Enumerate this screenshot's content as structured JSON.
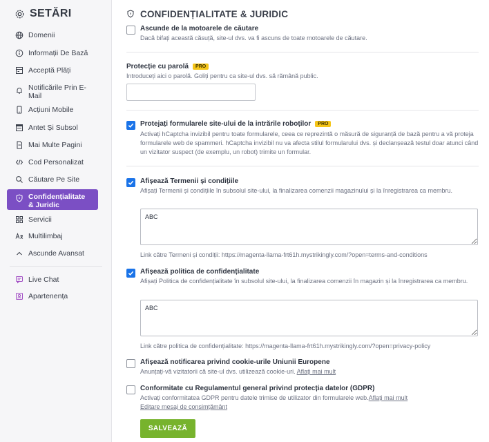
{
  "sidebar": {
    "title": "SETĂRI",
    "items": [
      {
        "label": "Domenii",
        "icon": "globe-icon"
      },
      {
        "label": "Informații De Bază",
        "icon": "info-icon"
      },
      {
        "label": "Acceptă Plăți",
        "icon": "payment-icon"
      },
      {
        "label": "Notificările Prin E-Mail",
        "icon": "bell-icon"
      },
      {
        "label": "Acțiuni Mobile",
        "icon": "mobile-icon"
      },
      {
        "label": "Antet Și Subsol",
        "icon": "header-footer-icon"
      },
      {
        "label": "Mai Multe Pagini",
        "icon": "pages-icon"
      },
      {
        "label": "Cod Personalizat",
        "icon": "code-icon"
      },
      {
        "label": "Căutare Pe Site",
        "icon": "search-icon"
      },
      {
        "label": "Confidențialitate & Juridic",
        "icon": "shield-icon",
        "active": true
      },
      {
        "label": "Servicii",
        "icon": "grid-icon"
      },
      {
        "label": "Multilimbaj",
        "icon": "translate-icon"
      },
      {
        "label": "Ascunde Avansat",
        "icon": "chevron-up-icon"
      }
    ],
    "extras": [
      {
        "label": "Live Chat",
        "icon": "chat-icon"
      },
      {
        "label": "Apartenența",
        "icon": "membership-icon"
      }
    ]
  },
  "page": {
    "title": "CONFIDENȚIALITATE & JURIDIC"
  },
  "options": {
    "hide_search": {
      "title": "Ascunde de la motoarele de căutare",
      "desc": "Dacă bifați această căsuță, site-ul dvs. va fi ascuns de toate motoarele de căutare.",
      "checked": false
    },
    "password": {
      "title": "Protecție cu parolă",
      "badge": "PRO",
      "desc": "Introduceți aici o parolă. Goliți pentru ca site-ul dvs. să rămână public.",
      "value": ""
    },
    "bot_protection": {
      "title": "Protejați formularele site-ului de la intrările roboților",
      "badge": "PRO",
      "desc": "Activați hCaptcha invizibil pentru toate formularele, ceea ce reprezintă o măsură de siguranță de bază pentru a vă proteja formularele web de spammeri. hCaptcha invizibil nu va afecta stilul formularului dvs. și declanșează testul doar atunci când un vizitator suspect (de exemplu, un robot) trimite un formular.",
      "checked": true
    },
    "terms": {
      "title": "Afișează Termenii și condițiile",
      "desc": "Afișați Termenii și condițiile în subsolul site-ului, la finalizarea comenzii magazinului și la înregistrarea ca membru.",
      "checked": true,
      "text": "ABC",
      "link": "Link către Termeni și condiții: https://magenta-llama-frt61h.mystrikingly.com/?open=terms-and-conditions"
    },
    "privacy": {
      "title": "Afișează politica de confidențialitate",
      "desc": "Afișați Politica de confidențialitate în subsolul site-ului, la finalizarea comenzii în magazin și la înregistrarea ca membru.",
      "checked": true,
      "text": "ABC",
      "link": "Link către politica de confidențialitate: https://magenta-llama-frt61h.mystrikingly.com/?open=privacy-policy"
    },
    "cookies": {
      "title": "Afișează notificarea privind cookie-urile Uniunii Europene",
      "desc": "Anunțați-vă vizitatorii că site-ul dvs. utilizează cookie-uri.",
      "more": "Aflați mai mult",
      "checked": false
    },
    "gdpr": {
      "title": "Conformitate cu Regulamentul general privind protecția datelor (GDPR)",
      "desc": "Activați conformitatea GDPR pentru datele trimise de utilizator din formularele web.",
      "more": "Aflați mai mult",
      "edit": "Editare mesaj de consimțământ",
      "checked": false
    }
  },
  "save_label": "SALVEAZĂ",
  "colors": {
    "active_nav": "#7b4fc4",
    "checkbox": "#1a73e8",
    "save": "#77b32d",
    "pro_badge": "#f5c518"
  }
}
